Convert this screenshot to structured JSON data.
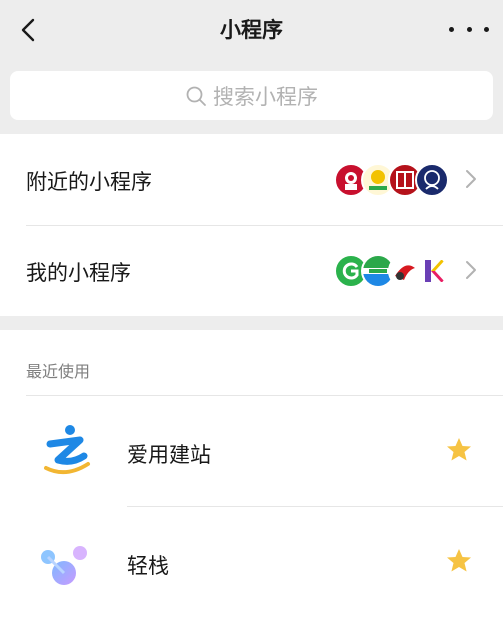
{
  "navbar": {
    "back_icon": "chevron-left-icon",
    "title": "小程序",
    "more_icon": "more-dots-icon"
  },
  "search": {
    "icon": "search-icon",
    "placeholder": "搜索小程序"
  },
  "menu": {
    "items": [
      {
        "label": "附近的小程序",
        "logos": [
          {
            "name": "kfc-logo",
            "color": "#c8102e"
          },
          {
            "name": "bao-logo",
            "color": "#f2c200"
          },
          {
            "name": "tao-logo",
            "color": "#b5121b"
          },
          {
            "name": "chef-logo",
            "color": "#1a2a6c"
          }
        ]
      },
      {
        "label": "我的小程序",
        "logos": [
          {
            "name": "g-logo",
            "color": "#2bb24c"
          },
          {
            "name": "familymart-logo",
            "color": "#2ba84a"
          },
          {
            "name": "bird-logo",
            "color": "#d71920"
          },
          {
            "name": "k-logo",
            "color": "#6a3fb5"
          }
        ]
      }
    ]
  },
  "recent": {
    "title": "最近使用",
    "items": [
      {
        "label": "爱用建站",
        "icon": "aiyong-jianzhan-icon",
        "starred": true
      },
      {
        "label": "轻栈",
        "icon": "qingzhan-icon",
        "starred": true
      }
    ]
  },
  "colors": {
    "background": "#ededed",
    "card": "#ffffff",
    "star": "#f6c343",
    "secondary_text": "#7f7f7f"
  }
}
